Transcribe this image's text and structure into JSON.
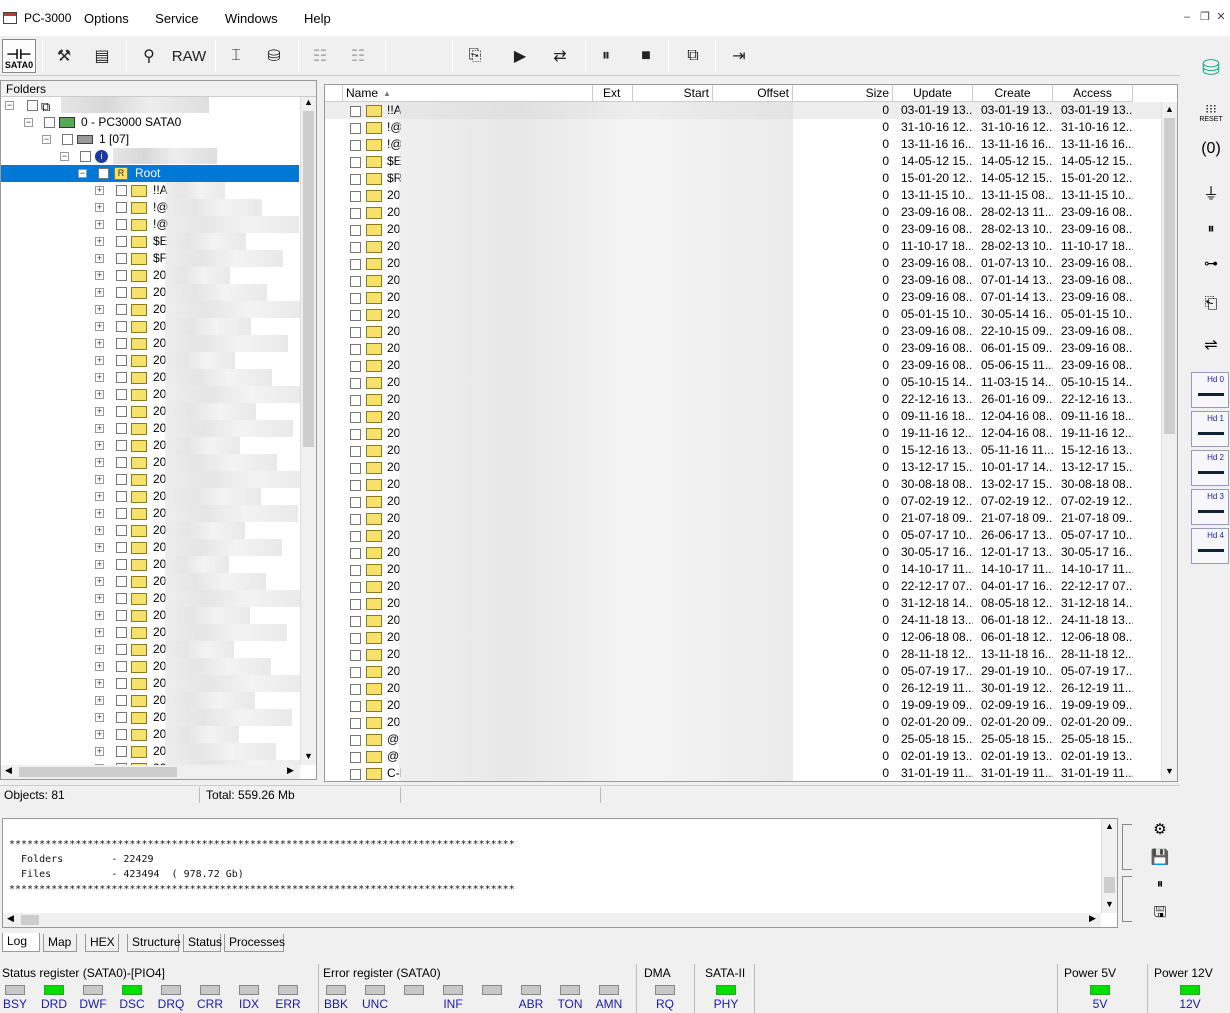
{
  "window": {
    "title": "PC-3000",
    "menu": [
      "Options",
      "Service",
      "Windows",
      "Help"
    ]
  },
  "toolbar": {
    "sata_label": "SATA0",
    "raw_label": "RAW"
  },
  "sidebar_right": {
    "reset_label": "RESET",
    "hd_labels": [
      "Hd 0",
      "Hd 1",
      "Hd 2",
      "Hd 3",
      "Hd 4"
    ]
  },
  "folders": {
    "header": "Folders",
    "tree": [
      {
        "label": "0 - PC3000 SATA0"
      },
      {
        "label": "1 [07]"
      },
      {
        "label": "Root"
      }
    ],
    "children": [
      "!!A",
      "!@",
      "!@",
      "$E",
      "$F",
      "20",
      "20",
      "20",
      "20",
      "20",
      "20",
      "20",
      "20",
      "20",
      "20",
      "20",
      "20",
      "20",
      "20",
      "20",
      "20",
      "20",
      "20",
      "20",
      "20",
      "20",
      "20",
      "20",
      "20",
      "20",
      "20",
      "20",
      "20",
      "20",
      "20",
      "20"
    ]
  },
  "filelist": {
    "columns": {
      "name": "Name",
      "ext": "Ext",
      "start": "Start",
      "offset": "Offset",
      "size": "Size",
      "update": "Update",
      "create": "Create",
      "access": "Access"
    },
    "rows": [
      {
        "name": "!!A",
        "size": "0",
        "update": "03-01-19 13...",
        "create": "03-01-19 13...",
        "access": "03-01-19 13..."
      },
      {
        "name": "!@",
        "size": "0",
        "update": "31-10-16 12...",
        "create": "31-10-16 12...",
        "access": "31-10-16 12..."
      },
      {
        "name": "!@",
        "size": "0",
        "update": "13-11-16 16...",
        "create": "13-11-16 16...",
        "access": "13-11-16 16..."
      },
      {
        "name": "$E",
        "size": "0",
        "update": "14-05-12 15...",
        "create": "14-05-12 15...",
        "access": "14-05-12 15..."
      },
      {
        "name": "$R",
        "size": "0",
        "update": "15-01-20 12...",
        "create": "14-05-12 15...",
        "access": "15-01-20 12..."
      },
      {
        "name": "20",
        "size": "0",
        "update": "13-11-15 10...",
        "create": "13-11-15 08...",
        "access": "13-11-15 10..."
      },
      {
        "name": "20",
        "size": "0",
        "update": "23-09-16 08...",
        "create": "28-02-13 11...",
        "access": "23-09-16 08..."
      },
      {
        "name": "20",
        "size": "0",
        "update": "23-09-16 08...",
        "create": "28-02-13 10...",
        "access": "23-09-16 08..."
      },
      {
        "name": "20",
        "size": "0",
        "update": "11-10-17 18...",
        "create": "28-02-13 10...",
        "access": "11-10-17 18..."
      },
      {
        "name": "20",
        "size": "0",
        "update": "23-09-16 08...",
        "create": "01-07-13 10...",
        "access": "23-09-16 08..."
      },
      {
        "name": "20",
        "size": "0",
        "update": "23-09-16 08...",
        "create": "07-01-14 13...",
        "access": "23-09-16 08..."
      },
      {
        "name": "20",
        "size": "0",
        "update": "23-09-16 08...",
        "create": "07-01-14 13...",
        "access": "23-09-16 08..."
      },
      {
        "name": "20",
        "size": "0",
        "update": "05-01-15 10...",
        "create": "30-05-14 16...",
        "access": "05-01-15 10..."
      },
      {
        "name": "20",
        "size": "0",
        "update": "23-09-16 08...",
        "create": "22-10-15 09...",
        "access": "23-09-16 08..."
      },
      {
        "name": "20",
        "size": "0",
        "update": "23-09-16 08...",
        "create": "06-01-15 09...",
        "access": "23-09-16 08..."
      },
      {
        "name": "20",
        "size": "0",
        "update": "23-09-16 08...",
        "create": "05-06-15 11...",
        "access": "23-09-16 08..."
      },
      {
        "name": "20",
        "size": "0",
        "update": "05-10-15 14...",
        "create": "11-03-15 14...",
        "access": "05-10-15 14..."
      },
      {
        "name": "20",
        "size": "0",
        "update": "22-12-16 13...",
        "create": "26-01-16 09...",
        "access": "22-12-16 13..."
      },
      {
        "name": "20",
        "size": "0",
        "update": "09-11-16 18...",
        "create": "12-04-16 08...",
        "access": "09-11-16 18..."
      },
      {
        "name": "20",
        "size": "0",
        "update": "19-11-16 12...",
        "create": "12-04-16 08...",
        "access": "19-11-16 12..."
      },
      {
        "name": "20",
        "size": "0",
        "update": "15-12-16 13...",
        "create": "05-11-16 11...",
        "access": "15-12-16 13..."
      },
      {
        "name": "20",
        "size": "0",
        "update": "13-12-17 15...",
        "create": "10-01-17 14...",
        "access": "13-12-17 15..."
      },
      {
        "name": "20",
        "size": "0",
        "update": "30-08-18 08...",
        "create": "13-02-17 15...",
        "access": "30-08-18 08..."
      },
      {
        "name": "20",
        "size": "0",
        "update": "07-02-19 12...",
        "create": "07-02-19 12...",
        "access": "07-02-19 12..."
      },
      {
        "name": "20",
        "size": "0",
        "update": "21-07-18 09...",
        "create": "21-07-18 09...",
        "access": "21-07-18 09..."
      },
      {
        "name": "20",
        "size": "0",
        "update": "05-07-17 10...",
        "create": "26-06-17 13...",
        "access": "05-07-17 10..."
      },
      {
        "name": "20",
        "size": "0",
        "update": "30-05-17 16...",
        "create": "12-01-17 13...",
        "access": "30-05-17 16..."
      },
      {
        "name": "20",
        "size": "0",
        "update": "14-10-17 11...",
        "create": "14-10-17 11...",
        "access": "14-10-17 11..."
      },
      {
        "name": "20",
        "size": "0",
        "update": "22-12-17 07...",
        "create": "04-01-17 16...",
        "access": "22-12-17 07..."
      },
      {
        "name": "20",
        "size": "0",
        "update": "31-12-18 14...",
        "create": "08-05-18 12...",
        "access": "31-12-18 14..."
      },
      {
        "name": "20",
        "size": "0",
        "update": "24-11-18 13...",
        "create": "06-01-18 12...",
        "access": "24-11-18 13..."
      },
      {
        "name": "20",
        "size": "0",
        "update": "12-06-18 08...",
        "create": "06-01-18 12...",
        "access": "12-06-18 08..."
      },
      {
        "name": "20",
        "size": "0",
        "update": "28-11-18 12...",
        "create": "13-11-18 16...",
        "access": "28-11-18 12..."
      },
      {
        "name": "20",
        "size": "0",
        "update": "05-07-19 17...",
        "create": "29-01-19 10...",
        "access": "05-07-19 17..."
      },
      {
        "name": "20",
        "size": "0",
        "update": "26-12-19 11...",
        "create": "30-01-19 12...",
        "access": "26-12-19 11..."
      },
      {
        "name": "20",
        "size": "0",
        "update": "19-09-19 09...",
        "create": "02-09-19 16...",
        "access": "19-09-19 09..."
      },
      {
        "name": "20",
        "size": "0",
        "update": "02-01-20 09...",
        "create": "02-01-20 09...",
        "access": "02-01-20 09..."
      },
      {
        "name": "@",
        "size": "0",
        "update": "25-05-18 15...",
        "create": "25-05-18 15...",
        "access": "25-05-18 15..."
      },
      {
        "name": "@",
        "size": "0",
        "update": "02-01-19 13...",
        "create": "02-01-19 13...",
        "access": "02-01-19 13..."
      },
      {
        "name": "C-N",
        "size": "0",
        "update": "31-01-19 11...",
        "create": "31-01-19 11...",
        "access": "31-01-19 11..."
      }
    ]
  },
  "statusline": {
    "objects": "Objects: 81",
    "total": "Total: 559.26 Mb"
  },
  "log": {
    "stars": "************************************************************************************",
    "folders_line": "  Folders        - 22429",
    "files_line": "  Files          - 423494  ( 978.72 Gb)"
  },
  "tabs": [
    "Log",
    "Map",
    "HEX",
    "Structure",
    "Status",
    "Processes"
  ],
  "registers": {
    "status_title": "Status register (SATA0)-[PIO4]",
    "status_bits": [
      {
        "label": "BSY",
        "on": false
      },
      {
        "label": "DRD",
        "on": true
      },
      {
        "label": "DWF",
        "on": false
      },
      {
        "label": "DSC",
        "on": true
      },
      {
        "label": "DRQ",
        "on": false
      },
      {
        "label": "CRR",
        "on": false
      },
      {
        "label": "IDX",
        "on": false
      },
      {
        "label": "ERR",
        "on": false
      }
    ],
    "error_title": "Error register (SATA0)",
    "error_bits": [
      {
        "label": "BBK",
        "on": false
      },
      {
        "label": "UNC",
        "on": false
      },
      {
        "label": "",
        "on": false
      },
      {
        "label": "INF",
        "on": false
      },
      {
        "label": "",
        "on": false
      },
      {
        "label": "ABR",
        "on": false
      },
      {
        "label": "TON",
        "on": false
      },
      {
        "label": "AMN",
        "on": false
      }
    ],
    "dma_title": "DMA",
    "dma_label": "RQ",
    "sata2_title": "SATA-II",
    "sata2_label": "PHY",
    "power5_title": "Power 5V",
    "power5_label": "5V",
    "power12_title": "Power 12V",
    "power12_label": "12V"
  },
  "colors": {
    "accent": "#0078d7",
    "led_on": "#00e000",
    "led_off": "#c8c8c8",
    "folder": "#f6e26a"
  }
}
